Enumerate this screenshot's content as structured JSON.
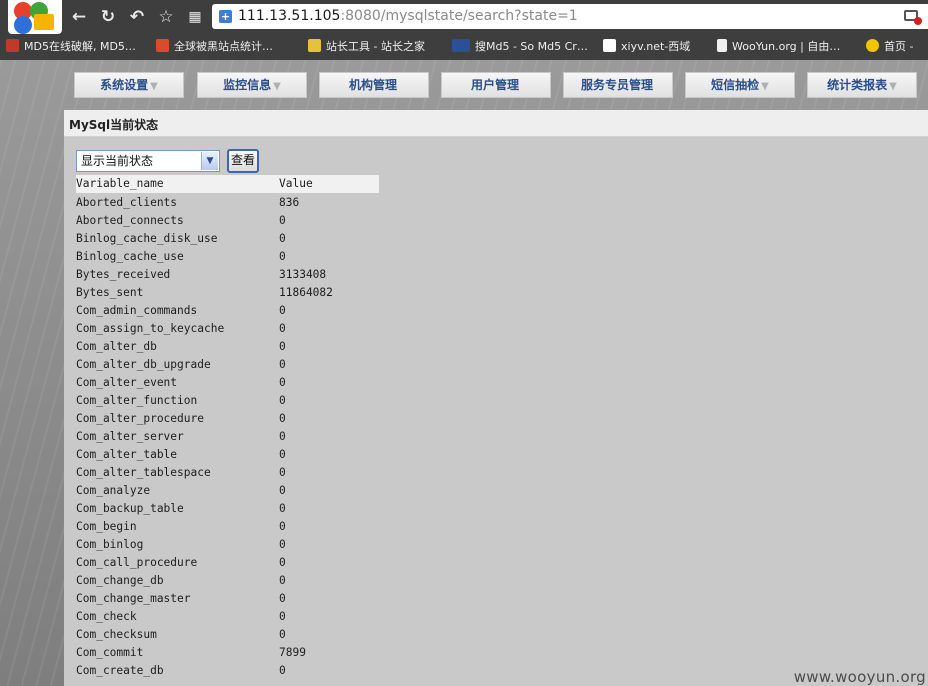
{
  "browser": {
    "address": {
      "host": "111.13.51.105",
      "rest": ":8080/mysqlstate/search?state=1"
    },
    "bookmarks": [
      {
        "label": "MD5在线破解, MD5…",
        "icon": "md5-site-icon"
      },
      {
        "label": "全球被黑站点统计…",
        "icon": "hacked-stats-icon"
      },
      {
        "label": "站长工具 - 站长之家",
        "icon": "chinaz-icon"
      },
      {
        "label": "搜Md5 - So Md5 Cr…",
        "icon": "somd5-icon"
      },
      {
        "label": "xiyv.net-西域",
        "icon": "xiyv-icon"
      },
      {
        "label": "WooYun.org | 自由…",
        "icon": "page-icon"
      },
      {
        "label": "首页 -",
        "icon": "plus-circle-icon"
      }
    ]
  },
  "menu": [
    {
      "label": "系统设置",
      "caret": "▼"
    },
    {
      "label": "监控信息",
      "caret": "▼"
    },
    {
      "label": "机构管理",
      "caret": ""
    },
    {
      "label": "用户管理",
      "caret": ""
    },
    {
      "label": "服务专员管理",
      "caret": ""
    },
    {
      "label": "短信抽检",
      "caret": "▼"
    },
    {
      "label": "统计类报表",
      "caret": "▼"
    }
  ],
  "panel": {
    "title": "MySql当前状态",
    "select_value": "显示当前状态",
    "view_button": "查看"
  },
  "table": {
    "headers": [
      "Variable_name",
      "Value"
    ],
    "rows": [
      [
        "Aborted_clients",
        "836"
      ],
      [
        "Aborted_connects",
        "0"
      ],
      [
        "Binlog_cache_disk_use",
        "0"
      ],
      [
        "Binlog_cache_use",
        "0"
      ],
      [
        "Bytes_received",
        "3133408"
      ],
      [
        "Bytes_sent",
        "11864082"
      ],
      [
        "Com_admin_commands",
        "0"
      ],
      [
        "Com_assign_to_keycache",
        "0"
      ],
      [
        "Com_alter_db",
        "0"
      ],
      [
        "Com_alter_db_upgrade",
        "0"
      ],
      [
        "Com_alter_event",
        "0"
      ],
      [
        "Com_alter_function",
        "0"
      ],
      [
        "Com_alter_procedure",
        "0"
      ],
      [
        "Com_alter_server",
        "0"
      ],
      [
        "Com_alter_table",
        "0"
      ],
      [
        "Com_alter_tablespace",
        "0"
      ],
      [
        "Com_analyze",
        "0"
      ],
      [
        "Com_backup_table",
        "0"
      ],
      [
        "Com_begin",
        "0"
      ],
      [
        "Com_binlog",
        "0"
      ],
      [
        "Com_call_procedure",
        "0"
      ],
      [
        "Com_change_db",
        "0"
      ],
      [
        "Com_change_master",
        "0"
      ],
      [
        "Com_check",
        "0"
      ],
      [
        "Com_checksum",
        "0"
      ],
      [
        "Com_commit",
        "7899"
      ],
      [
        "Com_create_db",
        "0"
      ]
    ]
  },
  "watermark": "www.wooyun.org"
}
